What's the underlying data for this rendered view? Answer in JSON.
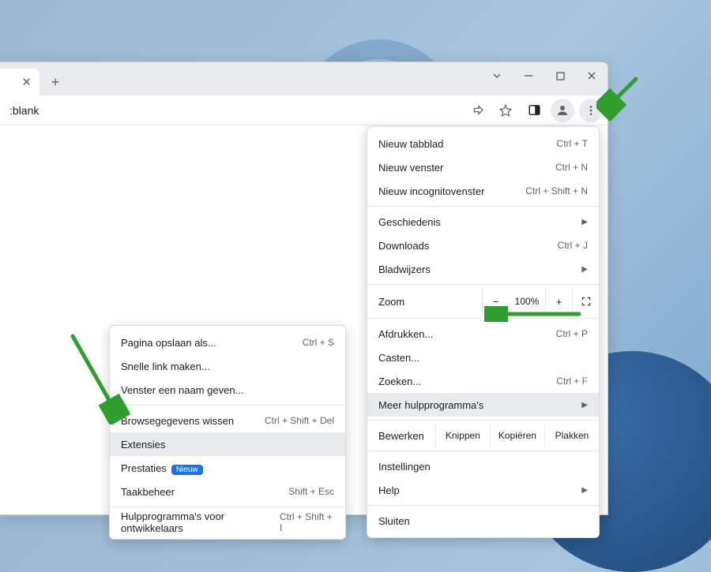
{
  "window_controls": {
    "dropdown": "⌄",
    "minimize": "—",
    "maximize": "▢",
    "close": "✕"
  },
  "tab": {
    "close_glyph": "✕",
    "newtab_glyph": "+"
  },
  "omnibox": {
    "text": ":blank"
  },
  "toolbar_icons": {
    "share": "share",
    "star": "star",
    "sidepanel": "sidepanel",
    "profile": "profile",
    "kebab": "⋮"
  },
  "menu": {
    "new_tab": "Nieuw tabblad",
    "new_tab_sc": "Ctrl + T",
    "new_window": "Nieuw venster",
    "new_window_sc": "Ctrl + N",
    "new_incognito": "Nieuw incognitovenster",
    "new_incognito_sc": "Ctrl + Shift + N",
    "history": "Geschiedenis",
    "downloads": "Downloads",
    "downloads_sc": "Ctrl + J",
    "bookmarks": "Bladwijzers",
    "zoom": "Zoom",
    "zoom_out": "−",
    "zoom_pct": "100%",
    "zoom_in": "+",
    "fullscreen": "⛶",
    "print": "Afdrukken...",
    "print_sc": "Ctrl + P",
    "cast": "Casten...",
    "find": "Zoeken...",
    "find_sc": "Ctrl + F",
    "more_tools": "Meer hulpprogramma's",
    "edit": "Bewerken",
    "cut": "Knippen",
    "copy": "Kopiëren",
    "paste": "Plakken",
    "settings": "Instellingen",
    "help": "Help",
    "exit": "Sluiten"
  },
  "submenu": {
    "save_page": "Pagina opslaan als...",
    "save_page_sc": "Ctrl + S",
    "create_shortcut": "Snelle link maken...",
    "name_window": "Venster een naam geven...",
    "clear_browsing": "Browsegegevens wissen",
    "clear_browsing_sc": "Ctrl + Shift + Del",
    "extensions": "Extensies",
    "performance": "Prestaties",
    "performance_badge": "Nieuw",
    "taskmgr": "Taakbeheer",
    "taskmgr_sc": "Shift + Esc",
    "devtools": "Hulpprogramma's voor ontwikkelaars",
    "devtools_sc": "Ctrl + Shift + I"
  }
}
